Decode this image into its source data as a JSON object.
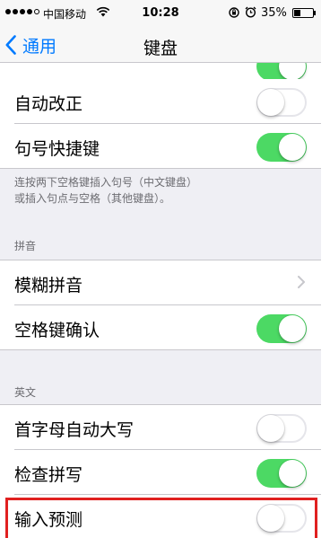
{
  "status_bar": {
    "carrier": "中国移动",
    "time": "10:28",
    "battery": "35%",
    "battery_level": 0.35
  },
  "nav": {
    "back_label": "通用",
    "title": "键盘"
  },
  "rows": {
    "auto_correct": {
      "label": "自动改正",
      "on": false
    },
    "period_shortcut": {
      "label": "句号快捷键",
      "on": true
    },
    "fuzzy_pinyin": {
      "label": "模糊拼音"
    },
    "space_confirm": {
      "label": "空格键确认",
      "on": true
    },
    "auto_capitalize": {
      "label": "首字母自动大写",
      "on": false
    },
    "check_spelling": {
      "label": "检查拼写",
      "on": true
    },
    "predictive": {
      "label": "输入预测",
      "on": false
    }
  },
  "period_footer": {
    "line1": "连按两下空格键插入句号（中文键盘）",
    "line2": "或插入句点与空格（其他键盘）。"
  },
  "sections": {
    "pinyin": "拼音",
    "english": "英文"
  },
  "colors": {
    "accent": "#007aff",
    "switch_on": "#4cd964",
    "highlight": "#e02020"
  }
}
